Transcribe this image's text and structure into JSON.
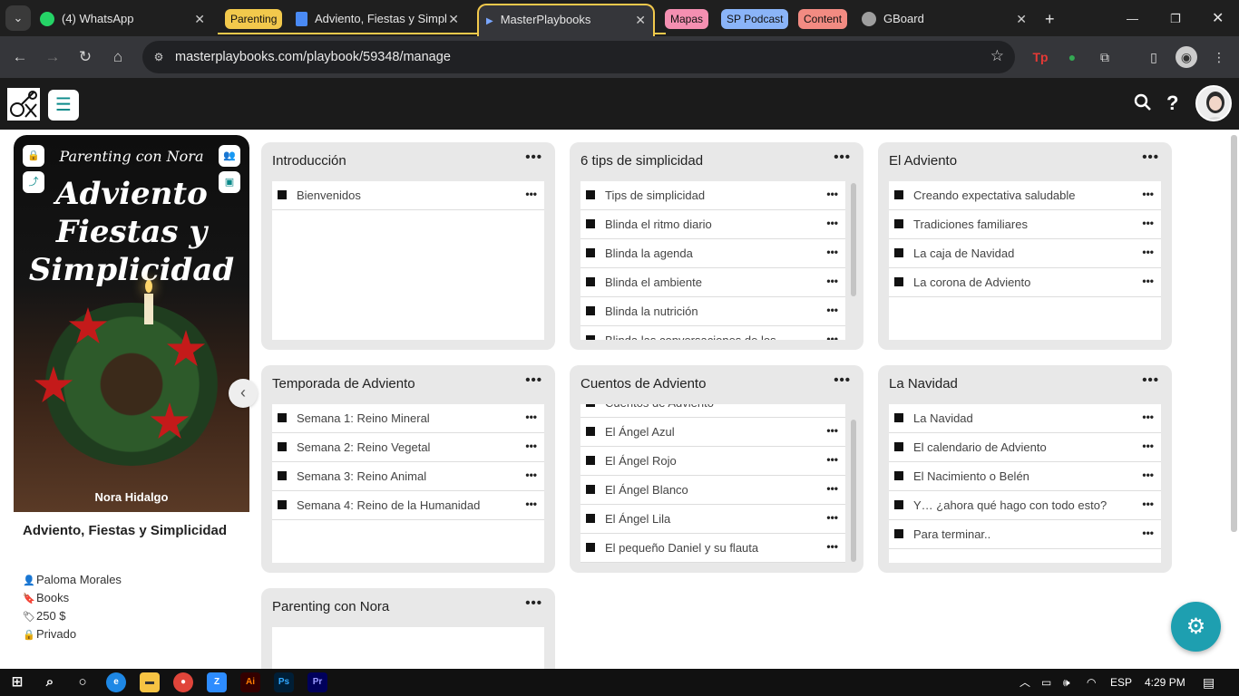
{
  "browser": {
    "tabs": [
      {
        "title": "(4) WhatsApp"
      },
      {
        "title": "Adviento, Fiestas y Simpl"
      },
      {
        "title": "MasterPlaybooks"
      },
      {
        "title": "GBoard"
      }
    ],
    "groups": [
      "Parenting",
      "Mapas",
      "SP Podcast",
      "Content"
    ],
    "url": "masterplaybooks.com/playbook/59348/manage",
    "colors": {
      "group_yellow": "#f2c94c",
      "group_pink": "#f48fb1",
      "group_blue": "#8ab4f8",
      "group_red": "#f28b82"
    }
  },
  "app": {
    "accent": "#1e9fb0"
  },
  "book": {
    "cover_brand": "Parenting con Nora",
    "cover_title_line1": "Adviento",
    "cover_title_line2": "Fiestas y",
    "cover_title_line3": "Simplicidad",
    "cover_author": "Nora Hidalgo",
    "title": "Adviento, Fiestas y Simplicidad",
    "author": "Paloma Morales",
    "category": "Books",
    "price": "250 $",
    "visibility": "Privado"
  },
  "sections": [
    {
      "title": "Introducción",
      "lessons": [
        "Bienvenidos"
      ]
    },
    {
      "title": "6 tips de simplicidad",
      "lessons": [
        "Tips de simplicidad",
        "Blinda el ritmo diario",
        "Blinda la agenda",
        "Blinda el ambiente",
        "Blinda la nutrición",
        "Blinda las conversaciones de los"
      ]
    },
    {
      "title": "El Adviento",
      "lessons": [
        "Creando expectativa saludable",
        "Tradiciones familiares",
        "La caja de Navidad",
        "La corona de Adviento"
      ]
    },
    {
      "title": "Temporada de Adviento",
      "lessons": [
        "Semana 1: Reino Mineral",
        "Semana 2: Reino Vegetal",
        "Semana 3: Reino Animal",
        "Semana 4: Reino de la Humanidad"
      ]
    },
    {
      "title": "Cuentos de Adviento",
      "lessons": [
        "Cuentos de Adviento",
        "El Ángel Azul",
        "El Ángel Rojo",
        "El Ángel Blanco",
        "El Ángel Lila",
        "El pequeño Daniel y su flauta"
      ]
    },
    {
      "title": "La Navidad",
      "lessons": [
        "La Navidad",
        "El calendario de Adviento",
        "El Nacimiento o Belén",
        "Y… ¿ahora qué hago con todo esto?",
        "Para terminar.."
      ]
    },
    {
      "title": "Parenting con Nora",
      "lessons": []
    }
  ],
  "taskbar": {
    "lang": "ESP",
    "time": "4:29 PM"
  }
}
